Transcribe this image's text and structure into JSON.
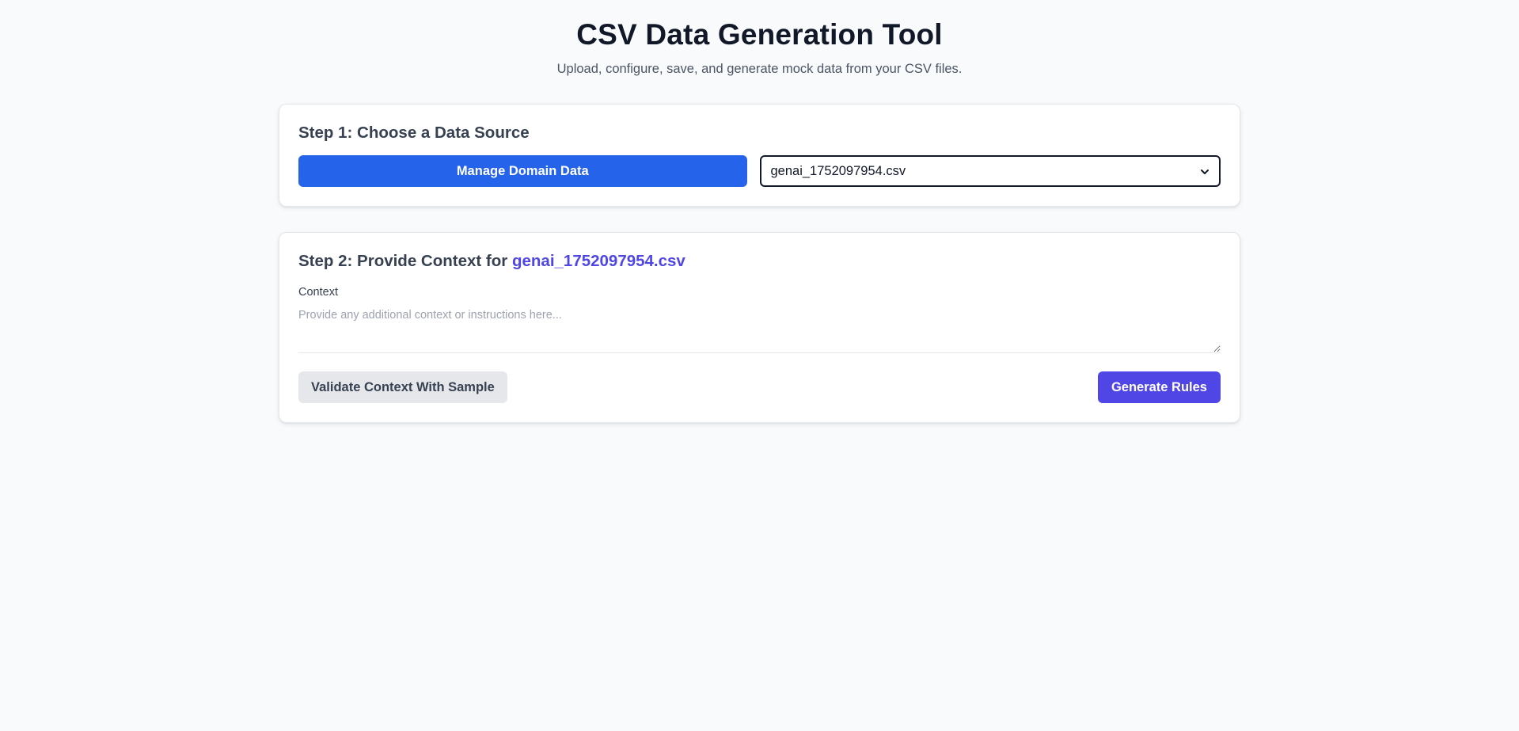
{
  "header": {
    "title": "CSV Data Generation Tool",
    "subtitle": "Upload, configure, save, and generate mock data from your CSV files."
  },
  "step1": {
    "title": "Step 1: Choose a Data Source",
    "manage_button_label": "Manage Domain Data",
    "data_source_select": {
      "selected_value": "genai_1752097954.csv",
      "icon": "chevron-down-icon"
    }
  },
  "step2": {
    "title_prefix": "Step 2: Provide Context for",
    "title_file": "genai_1752097954.csv",
    "context_label": "Context",
    "context_value": "",
    "context_placeholder": "Provide any additional context or instructions here...",
    "validate_button_label": "Validate Context With Sample",
    "generate_button_label": "Generate Rules"
  },
  "colors": {
    "background": "#f8fafc",
    "primary_blue": "#2563eb",
    "accent_indigo": "#4f46e5",
    "secondary_gray": "#e5e7eb"
  }
}
